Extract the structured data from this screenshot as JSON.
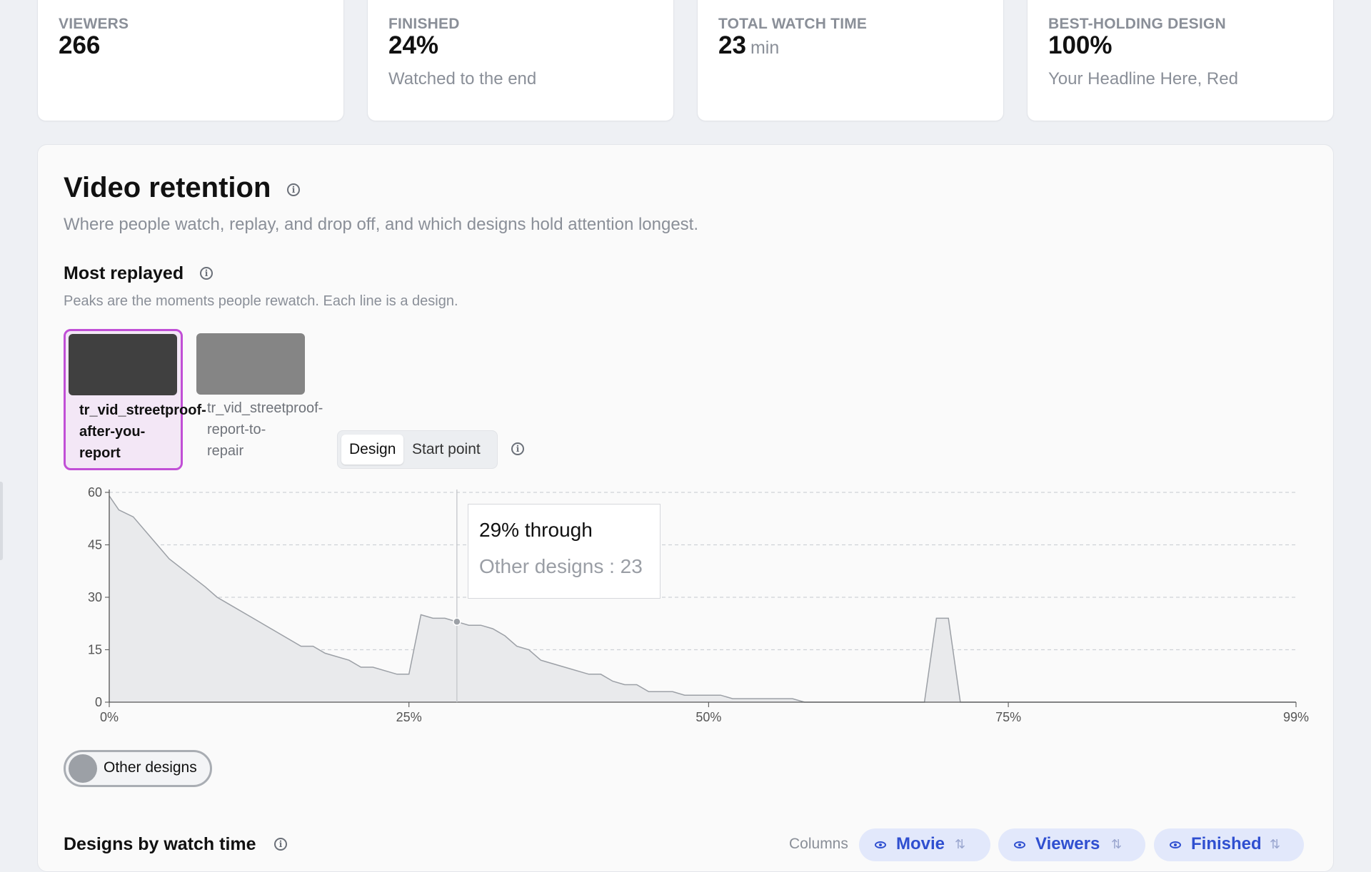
{
  "stats": [
    {
      "label": "VIEWERS",
      "value": "266",
      "unit": "",
      "sub": ""
    },
    {
      "label": "FINISHED",
      "value": "24%",
      "unit": "",
      "sub": "Watched to the end"
    },
    {
      "label": "TOTAL WATCH TIME",
      "value": "23",
      "unit": "min",
      "sub": ""
    },
    {
      "label": "BEST-HOLDING DESIGN",
      "value": "100%",
      "unit": "",
      "sub": "Your Headline Here, Red"
    }
  ],
  "panel": {
    "title": "Video retention",
    "subtitle": "Where people watch, replay, and drop off, and which designs hold attention longest.",
    "section_title": "Most replayed",
    "section_sub": "Peaks are the moments people rewatch. Each line is a design."
  },
  "designs": [
    {
      "lines": [
        "tr_vid_streetproof-",
        "after-you-",
        "report"
      ],
      "selected": true,
      "thumb_color": "#404040"
    },
    {
      "lines": [
        "tr_vid_streetproof-",
        "report-to-",
        "repair"
      ],
      "selected": false,
      "thumb_color": "#858585"
    }
  ],
  "toggle": {
    "options": [
      "Design",
      "Start point"
    ],
    "active": "Design"
  },
  "tooltip": {
    "title": "29% through",
    "body": "Other designs : 23"
  },
  "legend": {
    "label": "Other designs",
    "color": "#9ca0a6"
  },
  "bottom": {
    "title": "Designs by watch time",
    "columns_label": "Columns",
    "columns": [
      "Movie",
      "Viewers",
      "Finished"
    ]
  },
  "chart_data": {
    "type": "area",
    "x_tick_labels": [
      "0%",
      "25%",
      "50%",
      "75%",
      "99%"
    ],
    "y_tick_labels": [
      "0",
      "15",
      "30",
      "45",
      "60"
    ],
    "xlim": [
      0,
      99
    ],
    "ylim": [
      0,
      60
    ],
    "grid": true,
    "hover_x": 29,
    "hover_value": 23,
    "series": [
      {
        "name": "Other designs",
        "color": "#9ca0a6",
        "x": [
          0,
          0.8,
          2,
          3.5,
          5,
          6.5,
          8,
          9,
          10,
          12,
          14,
          16,
          17,
          18,
          20,
          21,
          22,
          24,
          25,
          26,
          27,
          28,
          29,
          30,
          31,
          32,
          33,
          34,
          35,
          36,
          38,
          40,
          41,
          42,
          43,
          44,
          45,
          46,
          47,
          48,
          49,
          50,
          51,
          52,
          53,
          54,
          55,
          56,
          57,
          58,
          68,
          69,
          70,
          71,
          72,
          99
        ],
        "values": [
          59,
          55,
          53,
          47,
          41,
          37,
          33,
          30,
          28,
          24,
          20,
          16,
          16,
          14,
          12,
          10,
          10,
          8,
          8,
          25,
          24,
          24,
          23,
          22,
          22,
          21,
          19,
          16,
          15,
          12,
          10,
          8,
          8,
          6,
          5,
          5,
          3,
          3,
          3,
          2,
          2,
          2,
          2,
          1,
          1,
          1,
          1,
          1,
          1,
          0,
          0,
          24,
          24,
          0,
          0,
          0
        ]
      }
    ]
  }
}
